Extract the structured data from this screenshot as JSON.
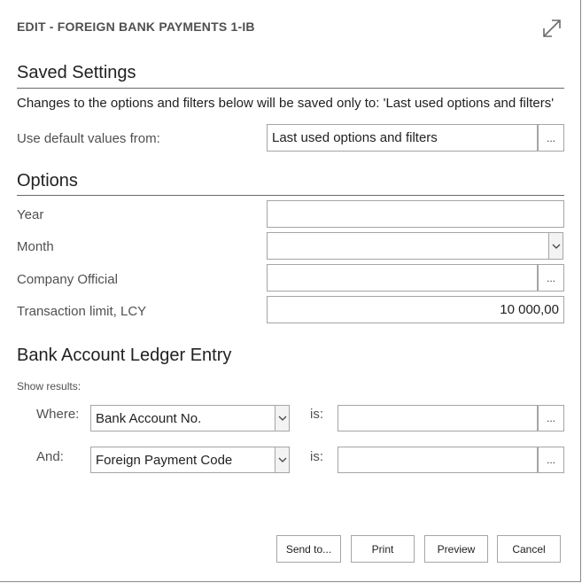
{
  "dialog": {
    "title": "EDIT - FOREIGN BANK PAYMENTS 1-IB"
  },
  "saved_settings": {
    "heading": "Saved Settings",
    "info": "Changes to the options and filters below will be saved only to: 'Last used options and filters'",
    "use_default_label": "Use default values from:",
    "use_default_value": "Last used options and filters",
    "ellipsis": "..."
  },
  "options": {
    "heading": "Options",
    "year_label": "Year",
    "year_value": "",
    "month_label": "Month",
    "month_value": "",
    "company_official_label": "Company Official",
    "company_official_value": "",
    "transaction_limit_label": "Transaction limit, LCY",
    "transaction_limit_value": "10 000,00"
  },
  "filters": {
    "heading": "Bank Account Ledger Entry",
    "show_results": "Show results:",
    "rows": [
      {
        "prefix": "Where:",
        "field": "Bank Account No.",
        "is_label": "is:",
        "value": ""
      },
      {
        "prefix": "And:",
        "field": "Foreign Payment Code",
        "is_label": "is:",
        "value": ""
      }
    ]
  },
  "footer": {
    "send_to": "Send to...",
    "print": "Print",
    "preview": "Preview",
    "cancel": "Cancel"
  },
  "icons": {
    "expand": "expand-icon",
    "dropdown": "chevron-down-icon"
  }
}
